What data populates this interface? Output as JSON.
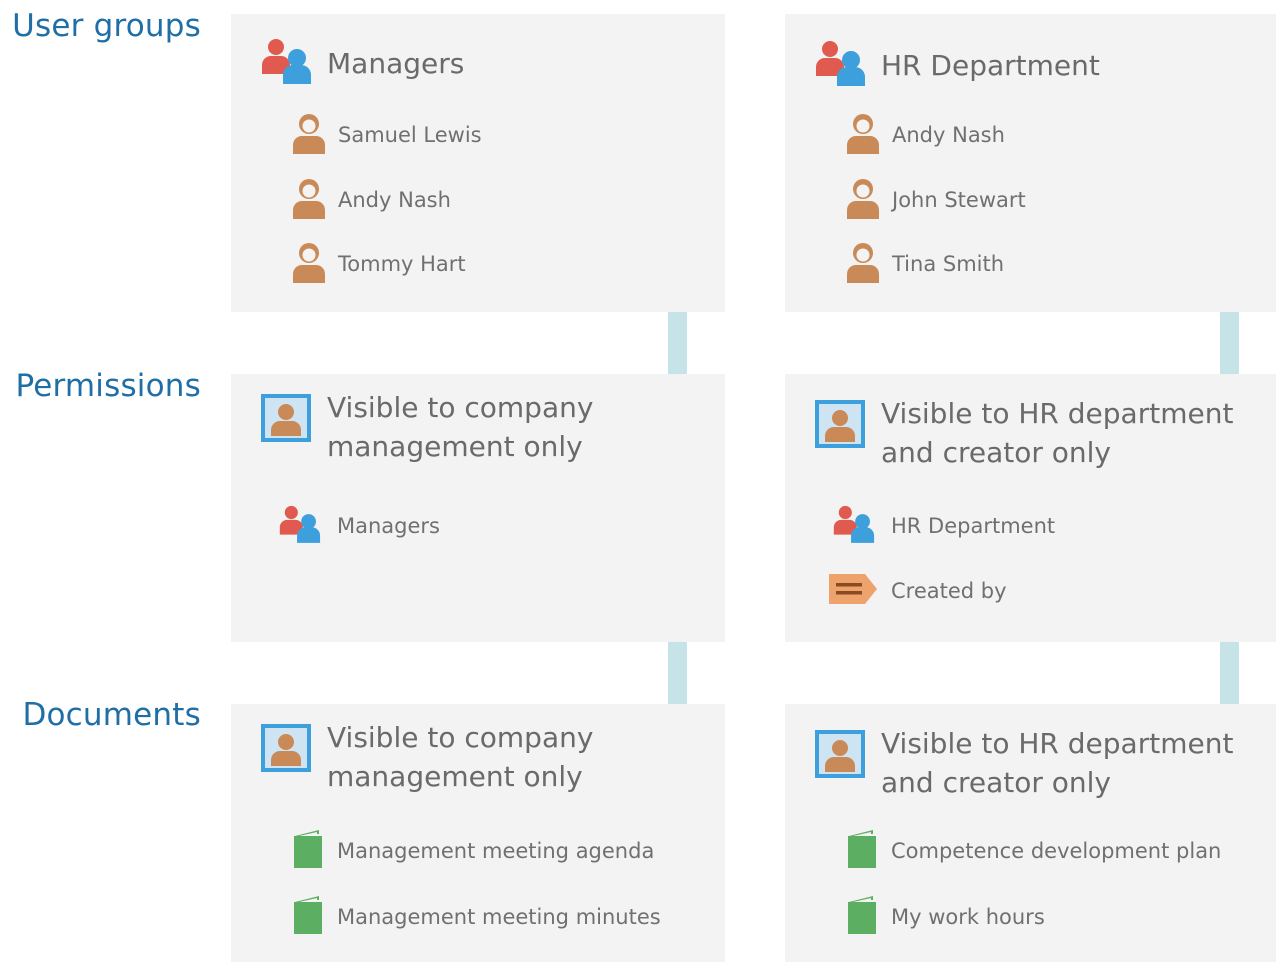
{
  "sections": {
    "user_groups": "User groups",
    "permissions": "Permissions",
    "documents": "Documents"
  },
  "groups": [
    {
      "name": "Managers",
      "members": [
        "Samuel Lewis",
        "Andy Nash",
        "Tommy Hart"
      ]
    },
    {
      "name": "HR Department",
      "members": [
        "Andy Nash",
        "John Stewart",
        "Tina Smith"
      ]
    }
  ],
  "permissions": [
    {
      "title": "Visible to company management only",
      "items": [
        {
          "icon": "user-group-icon",
          "label": "Managers"
        }
      ]
    },
    {
      "title": "Visible to HR department and creator only",
      "items": [
        {
          "icon": "user-group-icon",
          "label": "HR Department"
        },
        {
          "icon": "created-by-tag-icon",
          "label": "Created by"
        }
      ]
    }
  ],
  "documents": [
    {
      "title": "Visible to company management only",
      "items": [
        "Management meeting agenda",
        "Management meeting minutes"
      ]
    },
    {
      "title": "Visible to HR department and creator only",
      "items": [
        "Competence development plan",
        "My work hours"
      ]
    }
  ],
  "colors": {
    "section_label": "#1f6fa6",
    "card_bg": "#f3f3f3",
    "connector": "#c6e3e8",
    "person_icon": "#c98a58",
    "group_red": "#e05a4f",
    "group_blue": "#3d9fdc",
    "document_icon": "#5cae62",
    "tag_icon": "#eea36c"
  }
}
